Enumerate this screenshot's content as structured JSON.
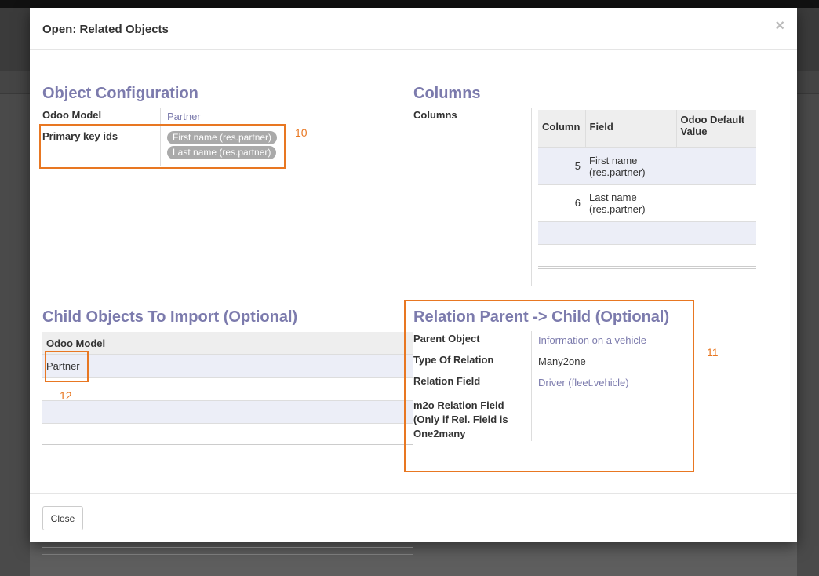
{
  "modal": {
    "title": "Open: Related Objects",
    "close_symbol": "×",
    "close_button": "Close"
  },
  "object_config": {
    "heading": "Object Configuration",
    "odoo_model_label": "Odoo Model",
    "odoo_model_value": "Partner",
    "primary_key_label": "Primary key ids",
    "primary_key_tags": [
      "First name (res.partner)",
      "Last name (res.partner)"
    ]
  },
  "columns": {
    "heading": "Columns",
    "label": "Columns",
    "headers": [
      "Column",
      "Field",
      "Odoo Default Value"
    ],
    "rows": [
      {
        "column": "5",
        "field": "First name (res.partner)",
        "default": ""
      },
      {
        "column": "6",
        "field": "Last name (res.partner)",
        "default": ""
      }
    ]
  },
  "child_objects": {
    "heading": "Child Objects To Import (Optional)",
    "header": "Odoo Model",
    "rows": [
      "Partner"
    ]
  },
  "relation": {
    "heading": "Relation Parent -> Child (Optional)",
    "parent_object_label": "Parent Object",
    "parent_object_value": "Information on a vehicle",
    "type_label": "Type Of Relation",
    "type_value": "Many2one",
    "relation_field_label": "Relation Field",
    "relation_field_value": "Driver (fleet.vehicle)",
    "m2o_label": "m2o Relation Field (Only if Rel. Field is One2many"
  },
  "annotations": [
    "10",
    "11",
    "12"
  ],
  "colors": {
    "heading": "#7c7bad",
    "annotation": "#e87722",
    "tag": "#aaaaaa"
  }
}
